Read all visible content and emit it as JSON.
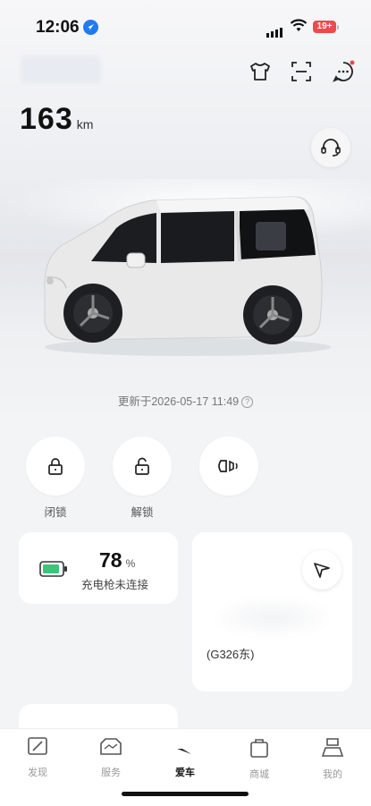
{
  "status_bar": {
    "time": "12:06",
    "battery": "19+"
  },
  "vehicle": {
    "range_value": "163",
    "range_unit": "km",
    "updated": "更新于2026-05-17 11:49"
  },
  "controls": [
    {
      "label": "闭锁",
      "icon": "lock-icon"
    },
    {
      "label": "解锁",
      "icon": "unlock-icon"
    },
    {
      "label": "",
      "icon": "horn-lights-icon"
    }
  ],
  "battery_card": {
    "percent": "78",
    "unit": "%",
    "status": "充电枪未连接"
  },
  "location_card": {
    "road": "(G326东)"
  },
  "tabbar": [
    {
      "label": "发现",
      "icon": "discover-icon",
      "active": false
    },
    {
      "label": "服务",
      "icon": "service-icon",
      "active": false
    },
    {
      "label": "爱车",
      "icon": "car-icon",
      "active": true
    },
    {
      "label": "商城",
      "icon": "shop-icon",
      "active": false
    },
    {
      "label": "我的",
      "icon": "profile-icon",
      "active": false
    }
  ],
  "colors": {
    "accent_green": "#3bc47a",
    "battery_red": "#e84c4c",
    "location_blue": "#1e7cf2"
  }
}
